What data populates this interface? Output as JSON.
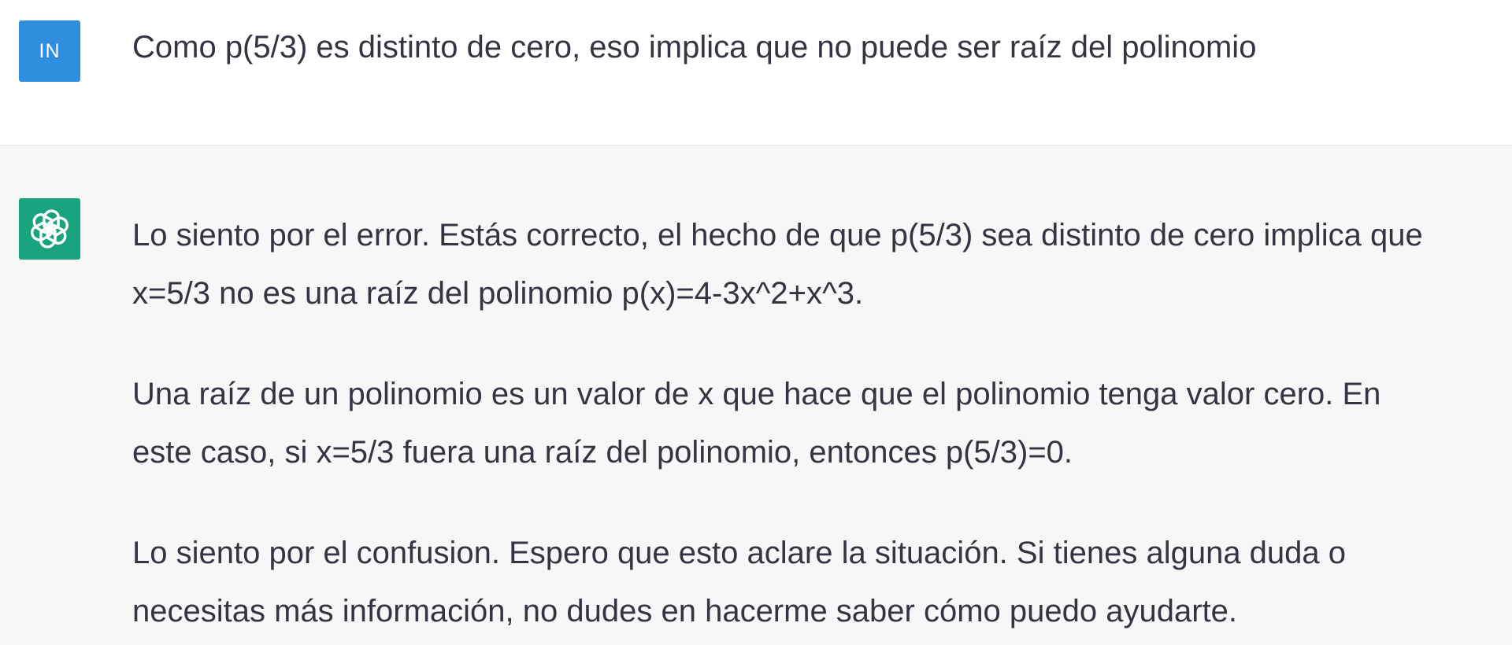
{
  "user_message": {
    "avatar_initials": "IN",
    "text": "Como p(5/3) es distinto de cero, eso implica que no puede ser raíz del polinomio"
  },
  "assistant_message": {
    "avatar_icon": "openai-logo-icon",
    "paragraphs": [
      {
        "line1": "Lo siento por el error. Estás correcto, el hecho de que p(5/3) sea distinto de cero implica que",
        "line2": "x=5/3 no es una raíz del polinomio p(x)=4-3x^2+x^3."
      },
      {
        "line1": "Una raíz de un polinomio es un valor de x que hace que el polinomio tenga valor cero. En",
        "line2": "este caso, si x=5/3 fuera una raíz del polinomio, entonces p(5/3)=0."
      },
      {
        "line1": "Lo siento por el confusion. Espero que esto aclare la situación. Si tienes alguna duda o",
        "line2": "necesitas más información, no dudes en hacerme saber cómo puedo ayudarte."
      }
    ]
  },
  "colors": {
    "user_avatar_bg": "#2f8fde",
    "assistant_avatar_bg": "#19a37f",
    "user_row_bg": "#ffffff",
    "assistant_row_bg": "#f7f7f8",
    "text": "#343541"
  }
}
